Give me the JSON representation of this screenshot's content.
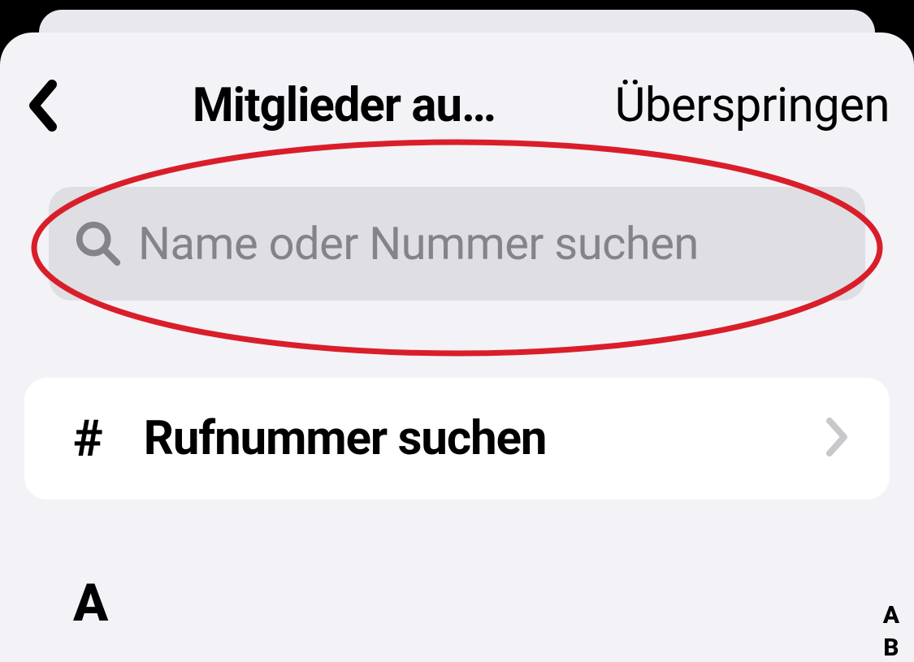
{
  "header": {
    "title": "Mitglieder au…",
    "skip": "Überspringen"
  },
  "search": {
    "placeholder": "Name oder Nummer suchen"
  },
  "phoneRow": {
    "label": "Rufnummer suchen",
    "hash": "#"
  },
  "sections": {
    "first": "A"
  },
  "index": {
    "letters": [
      "A",
      "B"
    ]
  }
}
